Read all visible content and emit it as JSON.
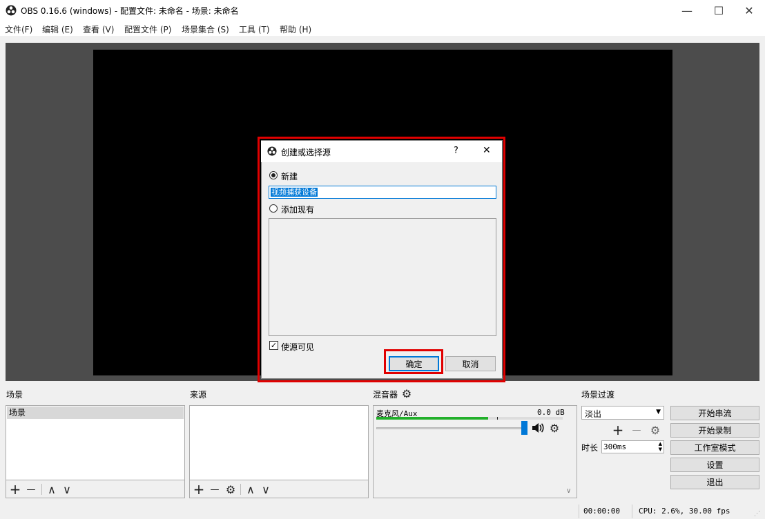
{
  "window": {
    "title": "OBS 0.16.6 (windows) - 配置文件: 未命名 - 场景: 未命名",
    "minimize": "—",
    "maximize": "☐",
    "close": "✕"
  },
  "menu": [
    "文件(F)",
    "编辑 (E)",
    "查看 (V)",
    "配置文件 (P)",
    "场景集合 (S)",
    "工具 (T)",
    "帮助 (H)"
  ],
  "dialog": {
    "title": "创建或选择源",
    "help": "?",
    "close": "✕",
    "new_label": "新建",
    "name_value": "视频捕获设备",
    "existing_label": "添加现有",
    "visible_label": "使源可见",
    "ok": "确定",
    "cancel": "取消"
  },
  "scenes": {
    "header": "场景",
    "items": [
      "场景"
    ]
  },
  "sources": {
    "header": "来源"
  },
  "mixer": {
    "header": "混音器",
    "channel_name": "麦克风/Aux",
    "db": "0.0 dB",
    "level": 0.6,
    "volume": 1.0
  },
  "transitions": {
    "header": "场景过渡",
    "selected": "淡出",
    "duration_label": "时长",
    "duration_value": "300ms"
  },
  "controls": {
    "start_stream": "开始串流",
    "start_record": "开始录制",
    "studio_mode": "工作室模式",
    "settings": "设置",
    "exit": "退出"
  },
  "status": {
    "time": "00:00:00",
    "cpu": "CPU: 2.6%, 30.00 fps"
  },
  "toolbar_symbols": {
    "add": "+",
    "remove": "—",
    "up": "∧",
    "down": "∨",
    "gear": "⚙"
  },
  "colors": {
    "highlight_red": "#e00000",
    "accent_blue": "#0078d7",
    "meter_green": "#22b02b"
  }
}
